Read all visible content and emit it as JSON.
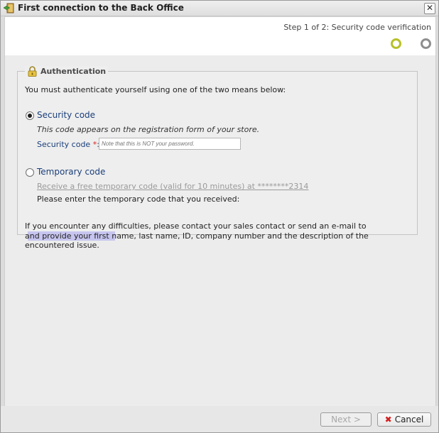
{
  "window": {
    "title": "First connection to the Back Office"
  },
  "step": {
    "label": "Step 1 of 2: Security code verification",
    "current": 1,
    "total": 2
  },
  "fieldset": {
    "legend": "Authentication",
    "intro": "You must authenticate yourself using one of the two means below:"
  },
  "option_security": {
    "label": "Security code",
    "selected": true,
    "hint": "This code appears on the registration form of your store.",
    "field_label": "Security code",
    "required_mark": "*",
    "field_colon": ":",
    "input_placeholder": "Note that this is NOT your password."
  },
  "option_temporary": {
    "label": "Temporary code",
    "selected": false,
    "link": "Receive a free temporary code (valid for 10 minutes) at ********2314",
    "instruction": "Please enter the temporary code that you received:"
  },
  "help": {
    "line1": "If you encounter any difficulties, please contact your sales contact or send an e-mail to",
    "line2": "and provide your first name, last name, ID, company number and the description of the encountered issue."
  },
  "buttons": {
    "next": "Next >",
    "cancel": "Cancel"
  },
  "colors": {
    "step_active": "#b8c028",
    "step_inactive": "#8e8e8e",
    "link_blue": "#1b3f7a",
    "required": "#dd2222"
  }
}
